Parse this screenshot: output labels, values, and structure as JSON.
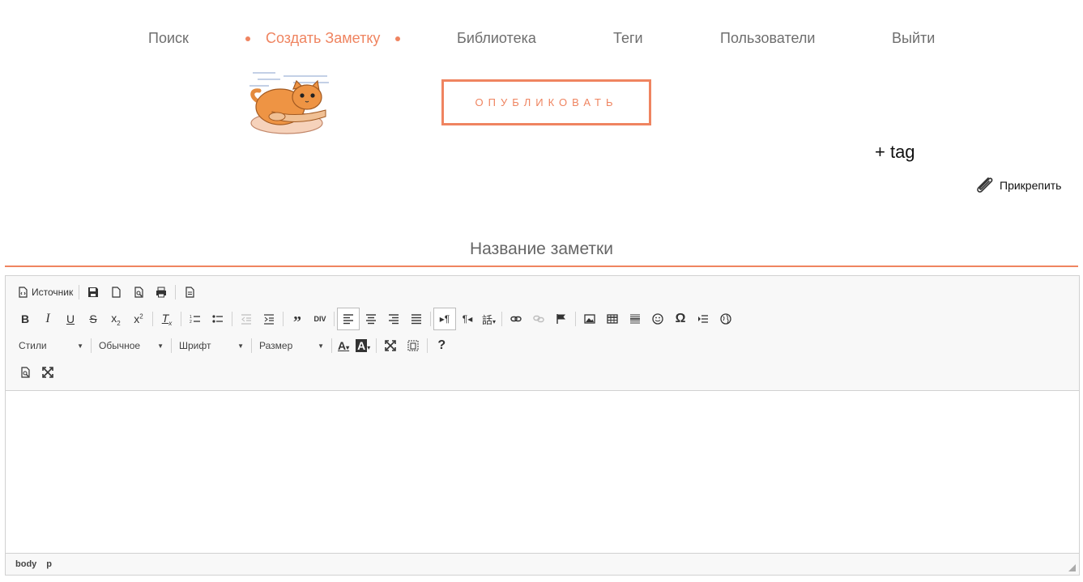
{
  "nav": {
    "search": "Поиск",
    "create": "Создать Заметку",
    "library": "Библиотека",
    "tags": "Теги",
    "users": "Пользователи",
    "logout": "Выйти"
  },
  "colors": {
    "accent": "#ef8460",
    "nav_text": "#6e6e6e"
  },
  "actions": {
    "publish": "ОПУБЛИКОВАТЬ",
    "add_tag": "+ tag",
    "attach": "Прикрепить"
  },
  "note": {
    "title_placeholder": "Название заметки",
    "title_value": ""
  },
  "editor": {
    "source_label": "Источник",
    "styles": "Стили",
    "format": "Обычное",
    "font": "Шрифт",
    "size": "Размер",
    "help": "?",
    "path": [
      "body",
      "p"
    ]
  },
  "icons": {
    "logo": "cat-logo-icon",
    "attach": "paperclip-icon",
    "toolbar": [
      "source-icon",
      "save-icon",
      "new-page-icon",
      "preview-icon",
      "print-icon",
      "templates-icon",
      "bold-icon",
      "italic-icon",
      "underline-icon",
      "strike-icon",
      "subscript-icon",
      "superscript-icon",
      "remove-format-icon",
      "numbered-list-icon",
      "bulleted-list-icon",
      "outdent-icon",
      "indent-icon",
      "blockquote-icon",
      "div-icon",
      "align-left-icon",
      "align-center-icon",
      "align-right-icon",
      "justify-icon",
      "ltr-icon",
      "rtl-icon",
      "language-icon",
      "link-icon",
      "unlink-icon",
      "anchor-icon",
      "image-icon",
      "table-icon",
      "horizontal-rule-icon",
      "smiley-icon",
      "special-char-icon",
      "page-break-icon",
      "iframe-icon",
      "text-color-icon",
      "bg-color-icon",
      "maximize-icon",
      "show-blocks-icon",
      "help-icon",
      "preview-icon",
      "maximize-icon"
    ]
  }
}
